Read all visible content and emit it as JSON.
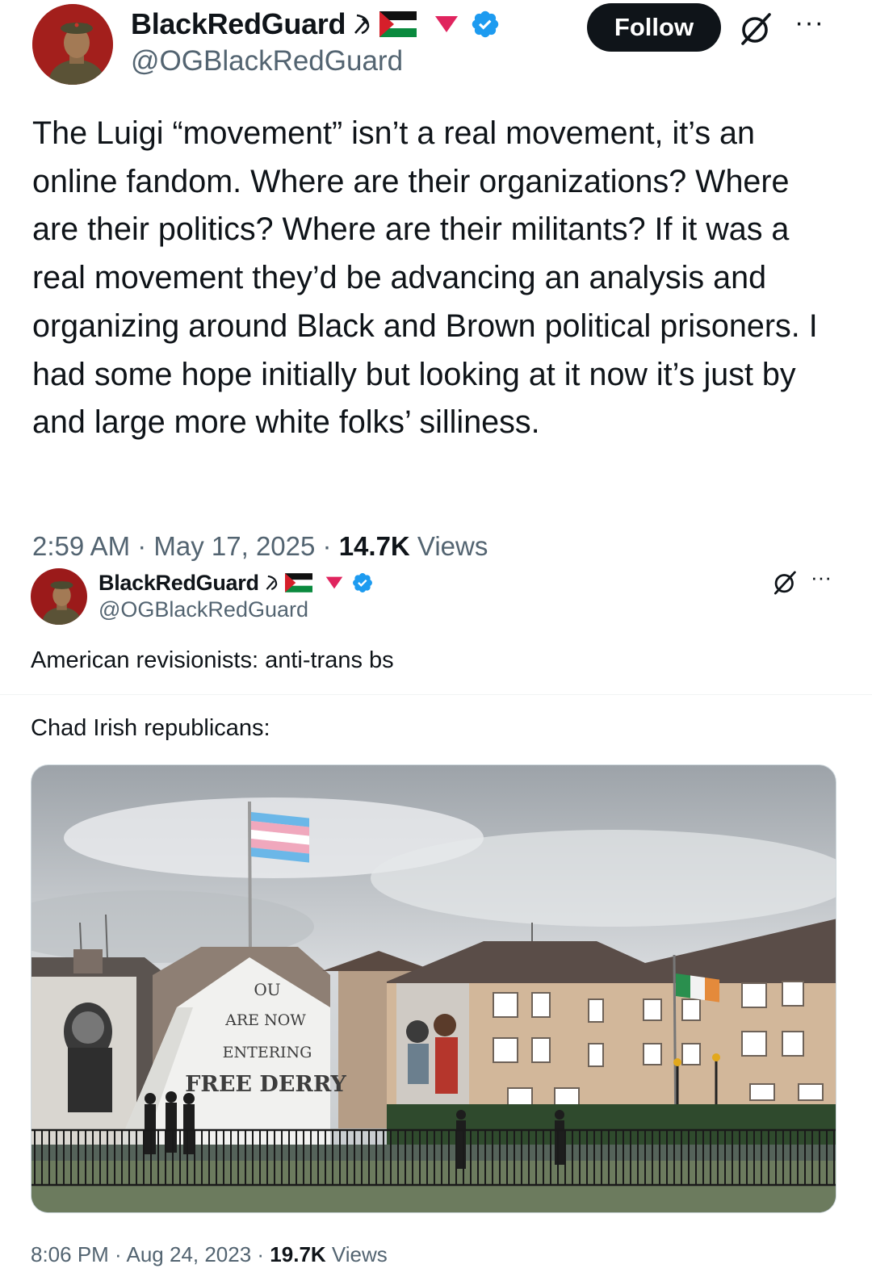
{
  "tweet1": {
    "display_name": "BlackRedGuard",
    "handle": "@OGBlackRedGuard",
    "follow_label": "Follow",
    "more_label": "···",
    "text": "The Luigi “movement” isn’t a real movement, it’s an online fandom. Where are their organizations? Where are their politics? Where are their militants? If it was a real movement they’d be advancing an analysis and organizing around Black and Brown political prisoners. I had some hope initially but looking at it now it’s just by and large more white folks’ silliness.",
    "time": "2:59 AM · May 17, 2025 · ",
    "views_count": "14.7K",
    "views_label": " Views",
    "name_emoji": [
      "hammer-sickle",
      "palestine-flag",
      "red-triangle"
    ],
    "verified_color": "#1d9bf0"
  },
  "tweet2": {
    "display_name": "BlackRedGuard",
    "handle": "@OGBlackRedGuard",
    "more_label": "···",
    "line1": "American revisionists: anti-trans bs",
    "line2": "Chad Irish republicans:",
    "mural_text": [
      "OU",
      "ARE NOW",
      "ENTERING",
      "FREE DERRY"
    ],
    "time": "8:06 PM · Aug 24, 2023 · ",
    "views_count": "19.7K",
    "views_label": " Views"
  },
  "colors": {
    "text_primary": "#0f1419",
    "text_secondary": "#536471",
    "follow_bg": "#0f1419",
    "verified": "#1d9bf0",
    "red_triangle": "#e0245e"
  }
}
